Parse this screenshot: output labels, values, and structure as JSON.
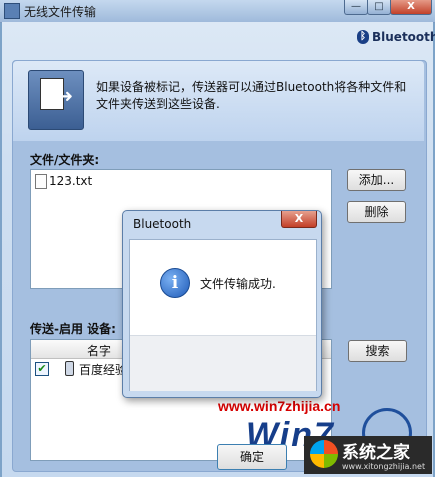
{
  "window": {
    "title": "无线文件传输",
    "min_label": "—",
    "max_label": "□",
    "close_label": "X"
  },
  "branding": {
    "bt_symbol": "ᛒ",
    "bt_text": "Bluetooth"
  },
  "header": {
    "description": "如果设备被标记，传送器可以通过Bluetooth将各种文件和文件夹传送到这些设备."
  },
  "files": {
    "label": "文件/文件夹:",
    "items": [
      {
        "name": "123.txt"
      }
    ],
    "add_label": "添加...",
    "remove_label": "删除"
  },
  "devices": {
    "label": "传送-启用 设备:",
    "column_name": "名字",
    "items": [
      {
        "name": "百度经验",
        "checked": "✔"
      }
    ],
    "search_label": "搜索"
  },
  "dialog": {
    "title": "Bluetooth",
    "close_label": "X",
    "info_glyph": "i",
    "message": "文件传输成功.",
    "ok_label": "确定"
  },
  "watermark": {
    "url": "www.win7zhijia.cn",
    "big_text": "Win7",
    "site_name": "系统之家",
    "site_url": "www.xitongzhijia.net"
  }
}
